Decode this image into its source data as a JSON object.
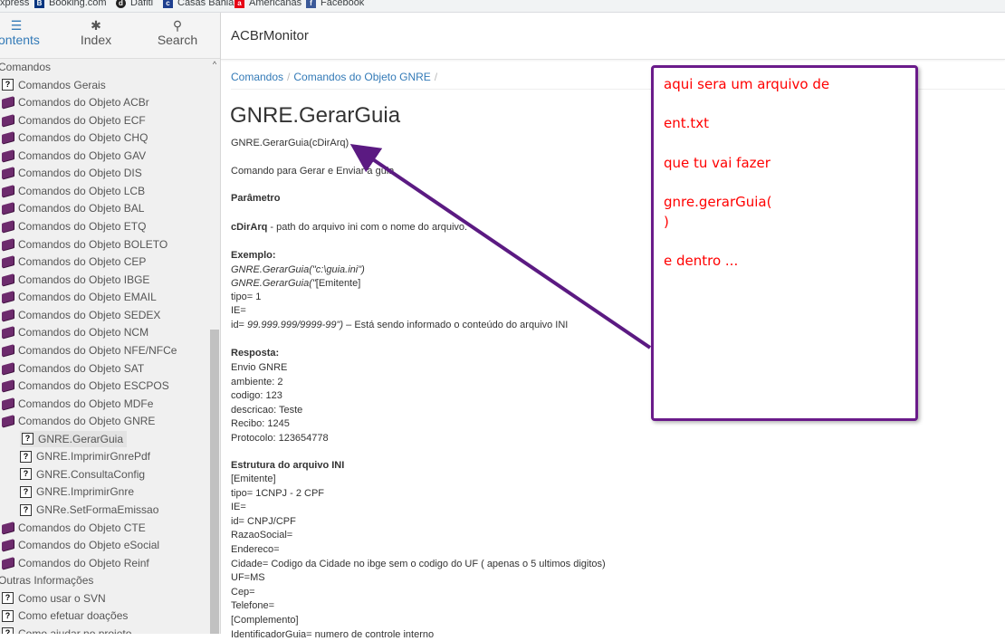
{
  "bookmarks": [
    {
      "label": "xpress",
      "icon": "aliexpress-icon",
      "color": "#e43225"
    },
    {
      "label": "Booking.com",
      "icon": "booking-icon",
      "color": "#003580"
    },
    {
      "label": "Dafiti",
      "icon": "dafiti-icon",
      "color": "#222222"
    },
    {
      "label": "Casas Bahia",
      "icon": "casas-bahia-icon",
      "color": "#1e3f8f"
    },
    {
      "label": "Americanas",
      "icon": "americanas-icon",
      "color": "#e60014"
    },
    {
      "label": "Facebook",
      "icon": "facebook-icon",
      "color": "#3b5998"
    }
  ],
  "tabs": [
    {
      "label": "ontents",
      "icon": "list-icon",
      "glyph": "☰",
      "active": true
    },
    {
      "label": "Index",
      "icon": "asterisk-icon",
      "glyph": "✱",
      "active": false
    },
    {
      "label": "Search",
      "icon": "search-icon",
      "glyph": "⚲",
      "active": false
    }
  ],
  "tree": [
    {
      "label": "Comandos",
      "type": "folder-open"
    },
    {
      "label": "Comandos Gerais",
      "type": "help"
    },
    {
      "label": "Comandos do Objeto ACBr",
      "type": "book"
    },
    {
      "label": "Comandos do Objeto ECF",
      "type": "book"
    },
    {
      "label": "Comandos do Objeto CHQ",
      "type": "book"
    },
    {
      "label": "Comandos do Objeto GAV",
      "type": "book"
    },
    {
      "label": "Comandos do Objeto DIS",
      "type": "book"
    },
    {
      "label": "Comandos do Objeto LCB",
      "type": "book"
    },
    {
      "label": "Comandos do Objeto BAL",
      "type": "book"
    },
    {
      "label": "Comandos do Objeto ETQ",
      "type": "book"
    },
    {
      "label": "Comandos do Objeto BOLETO",
      "type": "book"
    },
    {
      "label": "Comandos do Objeto CEP",
      "type": "book"
    },
    {
      "label": "Comandos do Objeto IBGE",
      "type": "book"
    },
    {
      "label": "Comandos do Objeto EMAIL",
      "type": "book"
    },
    {
      "label": "Comandos do Objeto SEDEX",
      "type": "book"
    },
    {
      "label": "Comandos do Objeto NCM",
      "type": "book"
    },
    {
      "label": "Comandos do Objeto NFE/NFCe",
      "type": "book"
    },
    {
      "label": "Comandos do Objeto SAT",
      "type": "book"
    },
    {
      "label": "Comandos do Objeto ESCPOS",
      "type": "book"
    },
    {
      "label": "Comandos do Objeto MDFe",
      "type": "book"
    },
    {
      "label": "Comandos do Objeto GNRE",
      "type": "book"
    },
    {
      "label": "GNRE.GerarGuia",
      "type": "help",
      "selected": true,
      "indent": 1
    },
    {
      "label": "GNRE.ImprimirGnrePdf",
      "type": "help",
      "indent": 1
    },
    {
      "label": "GNRE.ConsultaConfig",
      "type": "help",
      "indent": 1
    },
    {
      "label": "GNRE.ImprimirGnre",
      "type": "help",
      "indent": 1
    },
    {
      "label": "GNRe.SetFormaEmissao",
      "type": "help",
      "indent": 1
    },
    {
      "label": "Comandos do Objeto CTE",
      "type": "book"
    },
    {
      "label": "Comandos do Objeto eSocial",
      "type": "book"
    },
    {
      "label": "Comandos do Objeto Reinf",
      "type": "book"
    },
    {
      "label": "Outras Informações",
      "type": "folder-open"
    },
    {
      "label": "Como usar o SVN",
      "type": "help"
    },
    {
      "label": "Como efetuar doações",
      "type": "help"
    },
    {
      "label": "Como ajudar no projeto",
      "type": "help"
    }
  ],
  "header": {
    "title": "ACBrMonitor"
  },
  "breadcrumb": [
    "Comandos",
    "Comandos do Objeto GNRE"
  ],
  "content": {
    "title": "GNRE.GerarGuia",
    "signature": "GNRE.GerarGuia(cDirArq)",
    "description": "Comando para Gerar e Enviar a guia",
    "param_heading": "Parâmetro",
    "param_name": "cDirArq",
    "param_desc": " - path do arquivo ini com o nome do arquivo.",
    "example_heading": "Exemplo:",
    "example_1": "GNRE.GerarGuia(\"c:\\guia.ini\")",
    "example_2_italic": "GNRE.GerarGuia(\"",
    "example_2_rest": "[Emitente]",
    "ex_tipo": "tipo= 1",
    "ex_ie": "IE=",
    "ex_id_prefix": "id= ",
    "ex_id_italic": "99.999.999/9999-99\")",
    "ex_id_suffix": " – Está sendo informado o conteúdo do arquivo INI",
    "response_heading": "Resposta:",
    "response_lines": [
      "Envio GNRE",
      "ambiente: 2",
      "codigo: 123",
      "descricao: Teste",
      "Recibo: 1245",
      "Protocolo: 123654778"
    ],
    "structure_heading": "Estrutura do arquivo INI",
    "structure_lines": [
      "[Emitente]",
      "tipo= 1CNPJ - 2 CPF",
      "IE=",
      "id= CNPJ/CPF",
      "RazaoSocial=",
      "Endereco=",
      "Cidade= Codigo da Cidade no ibge sem o codigo do UF ( apenas o 5 ultimos digitos)",
      "UF=MS",
      "Cep=",
      "Telefone=",
      "[Complemento]",
      "IdentificadorGuia= numero de controle interno"
    ]
  },
  "note": {
    "lines": [
      "aqui sera um arquivo de",
      "ent.txt",
      "que tu vai fazer",
      "gnre.gerarGuia(",
      ")",
      "e dentro ..."
    ],
    "text_color": "#ff0000",
    "border_color": "#6a1b8a"
  },
  "arrow_color": "#5b1a82"
}
